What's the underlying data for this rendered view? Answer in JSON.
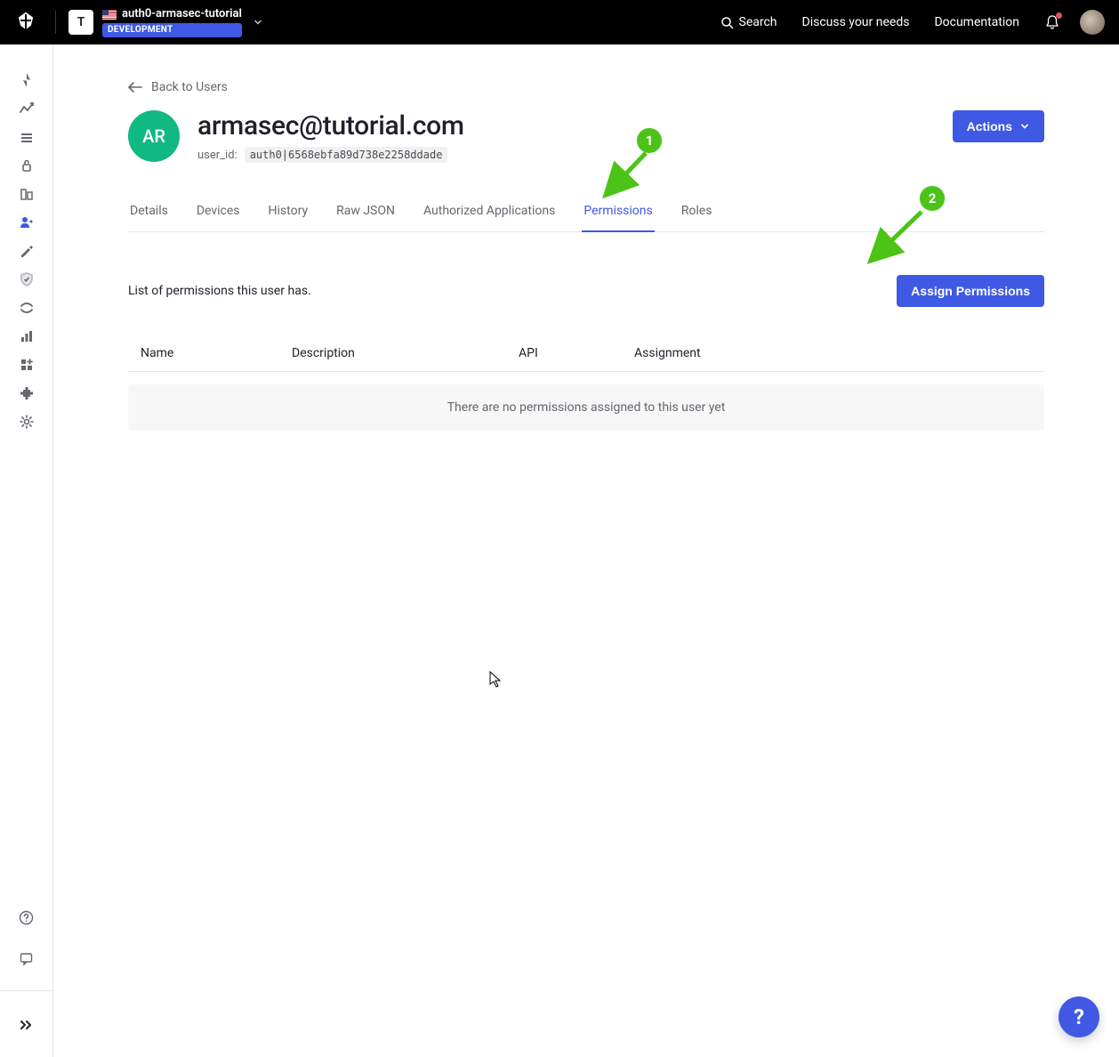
{
  "topbar": {
    "tenant_initial": "T",
    "tenant_name": "auth0-armasec-tutorial",
    "env_badge": "DEVELOPMENT",
    "search_label": "Search",
    "discuss_label": "Discuss your needs",
    "docs_label": "Documentation"
  },
  "back_link": "Back to Users",
  "user": {
    "avatar_initials": "AR",
    "email": "armasec@tutorial.com",
    "id_label": "user_id:",
    "id_value": "auth0|6568ebfa89d738e2258ddade"
  },
  "actions_button": "Actions",
  "tabs": [
    {
      "label": "Details",
      "active": false
    },
    {
      "label": "Devices",
      "active": false
    },
    {
      "label": "History",
      "active": false
    },
    {
      "label": "Raw JSON",
      "active": false
    },
    {
      "label": "Authorized Applications",
      "active": false
    },
    {
      "label": "Permissions",
      "active": true
    },
    {
      "label": "Roles",
      "active": false
    }
  ],
  "permissions": {
    "description": "List of permissions this user has.",
    "assign_button": "Assign Permissions",
    "columns": [
      "Name",
      "Description",
      "API",
      "Assignment"
    ],
    "empty_message": "There are no permissions assigned to this user yet"
  },
  "annotations": {
    "one": "1",
    "two": "2"
  },
  "help_fab": "?"
}
